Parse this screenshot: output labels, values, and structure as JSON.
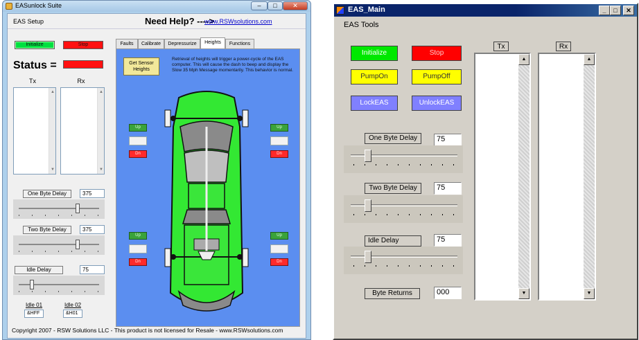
{
  "left_window": {
    "title": "EASunlock Suite",
    "controls": {
      "min": "–",
      "max": "□",
      "close": "✕"
    },
    "menu": "EAS Setup",
    "help_text": "Need Help? ---->",
    "help_url": "www.RSWsolutions.com",
    "initialize": "Initialize",
    "stop": "Stop",
    "status_label": "Status =",
    "tx": "Tx",
    "rx": "Rx",
    "one_byte_delay": {
      "label": "One Byte Delay",
      "value": "375"
    },
    "two_byte_delay": {
      "label": "Two Byte Delay",
      "value": "375"
    },
    "idle_delay": {
      "label": "Idle Delay",
      "value": "75"
    },
    "idle01": {
      "label": "Idle 01",
      "value": "&HFF"
    },
    "idle02": {
      "label": "Idle 02",
      "value": "&H01"
    },
    "tabs": [
      "Faults",
      "Calibrate",
      "Depressurize",
      "Heights",
      "Functions"
    ],
    "active_tab": "Heights",
    "sensor_button": "Get Sensor Heights",
    "info": "Retrieval of heights will trigger a power-cycle of the EAS computer. This will cause the dash to beep and display the Slow 35 Mph Message momentarily. This behavior is normal.",
    "up": "Up",
    "dn": "Dn",
    "footer": "Copyright 2007 - RSW Solutions LLC - This product is not licensed for Resale - www.RSWsolutions.com"
  },
  "right_window": {
    "title": "EAS_Main",
    "controls": {
      "min": "_",
      "max": "□",
      "close": "✕"
    },
    "menu": "EAS Tools",
    "initialize": "Initialize",
    "stop": "Stop",
    "pump_on": "PumpOn",
    "pump_off": "PumpOff",
    "lock": "LockEAS",
    "unlock": "UnlockEAS",
    "one_byte_delay": {
      "label": "One Byte Delay",
      "value": "75"
    },
    "two_byte_delay": {
      "label": "Two Byte Delay",
      "value": "75"
    },
    "idle_delay": {
      "label": "Idle Delay",
      "value": "75"
    },
    "byte_returns": {
      "label": "Byte Returns",
      "value": "000"
    },
    "tx": "Tx",
    "rx": "Rx"
  }
}
